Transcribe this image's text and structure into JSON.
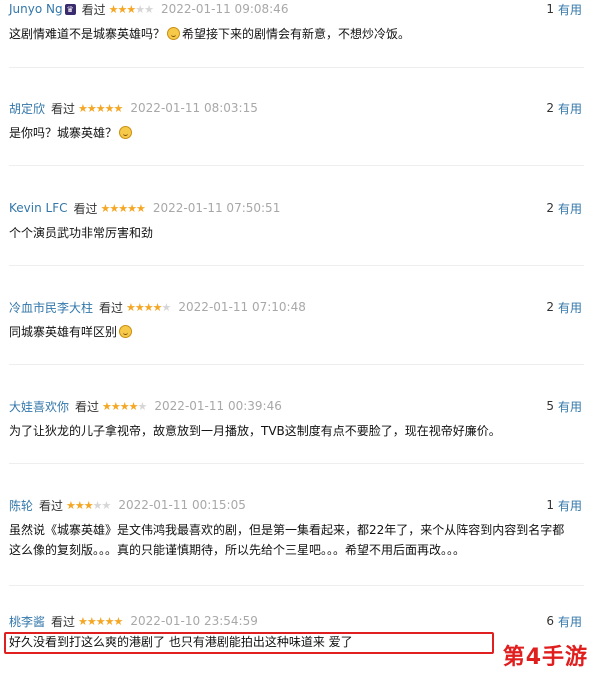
{
  "vote_label": "有用",
  "comments": [
    {
      "user": "Junyo Ng",
      "has_badge": true,
      "status": "看过",
      "rating": 3,
      "date": "2022-01-11 09:08:46",
      "votes": "1",
      "lines": [
        {
          "text": "这剧情难道不是城寨英雄吗？",
          "emoji_after": true,
          "rest": "希望接下来的剧情会有新意，不想炒冷饭。"
        }
      ]
    },
    {
      "user": "胡定欣",
      "has_badge": false,
      "status": "看过",
      "rating": 5,
      "date": "2022-01-11 08:03:15",
      "votes": "2",
      "lines": [
        {
          "text": "是你吗？城寨英雄？",
          "emoji_after": true,
          "rest": ""
        }
      ]
    },
    {
      "user": "Kevin LFC",
      "has_badge": false,
      "status": "看过",
      "rating": 5,
      "date": "2022-01-11 07:50:51",
      "votes": "2",
      "lines": [
        {
          "text": "个个演员武功非常厉害和劲",
          "emoji_after": false,
          "rest": ""
        }
      ]
    },
    {
      "user": "冷血市民李大柱",
      "has_badge": false,
      "status": "看过",
      "rating": 4,
      "date": "2022-01-11 07:10:48",
      "votes": "2",
      "lines": [
        {
          "text": "同城寨英雄有咩区别",
          "emoji_after": true,
          "rest": ""
        }
      ]
    },
    {
      "user": "大娃喜欢你",
      "has_badge": false,
      "status": "看过",
      "rating": 4,
      "date": "2022-01-11 00:39:46",
      "votes": "5",
      "lines": [
        {
          "text": "为了让狄龙的儿子拿视帝，故意放到一月播放，TVB这制度有点不要脸了，现在视帝好廉价。",
          "emoji_after": false,
          "rest": ""
        }
      ]
    },
    {
      "user": "陈轮",
      "has_badge": false,
      "status": "看过",
      "rating": 3,
      "date": "2022-01-11 00:15:05",
      "votes": "1",
      "lines": [
        {
          "text": "虽然说《城寨英雄》是文伟鸿我最喜欢的剧，但是第一集看起来，都22年了，来个从阵容到内容到名字都",
          "emoji_after": false,
          "rest": ""
        },
        {
          "text": "这么像的复刻版。。。真的只能谨慎期待，所以先给个三星吧。。。希望不用后面再改。。。",
          "emoji_after": false,
          "rest": ""
        }
      ]
    },
    {
      "user": "桃李酱",
      "has_badge": false,
      "status": "看过",
      "rating": 5,
      "date": "2022-01-10 23:54:59",
      "votes": "6",
      "lines": [
        {
          "text": "好久没看到打这么爽的港剧了 也只有港剧能拍出这种味道来 爱了",
          "emoji_after": false,
          "rest": ""
        }
      ]
    }
  ],
  "watermark": "第4手游",
  "colors": {
    "link": "#3377aa",
    "star": "#f5a623",
    "highlight": "#e02020",
    "watermark": "#e01e1e"
  }
}
